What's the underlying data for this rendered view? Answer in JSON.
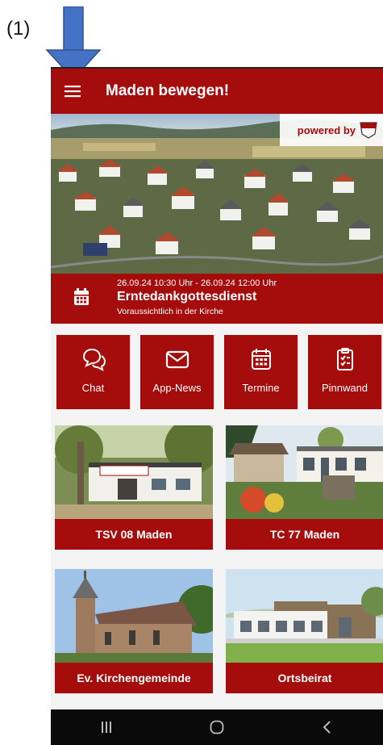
{
  "annotation": {
    "step_label": "(1)",
    "arrow_color": "#4472c4"
  },
  "theme": {
    "primary": "#a50d0d",
    "text_on_primary": "#ffffff"
  },
  "appbar": {
    "title": "Maden bewegen!",
    "menu_icon": "hamburger-menu-icon"
  },
  "hero": {
    "powered_by": "powered by",
    "image": "aerial view of village Maden"
  },
  "event": {
    "date": "26.09.24 10:30 Uhr - 26.09.24 12:00 Uhr",
    "title": "Erntedankgottesdienst",
    "location": "Voraussichtlich in der Kirche",
    "icon": "calendar-icon"
  },
  "tiles": [
    {
      "label": "Chat",
      "icon": "chat-icon"
    },
    {
      "label": "App-News",
      "icon": "mail-icon"
    },
    {
      "label": "Termine",
      "icon": "calendar-icon"
    },
    {
      "label": "Pinnwand",
      "icon": "clipboard-icon"
    }
  ],
  "cards": [
    {
      "label": "TSV 08 Maden",
      "sign": "TSV 08 Maden e.V."
    },
    {
      "label": "TC 77 Maden"
    },
    {
      "label": "Ev. Kirchengemeinde"
    },
    {
      "label": "Ortsbeirat"
    }
  ],
  "navbar": [
    "recent-apps-icon",
    "home-icon",
    "back-icon"
  ]
}
